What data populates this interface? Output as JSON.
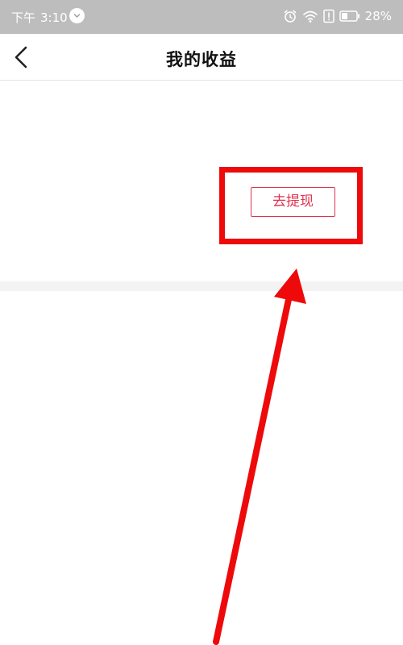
{
  "status_bar": {
    "period": "下午",
    "time": "3:10",
    "battery_percent": "28%",
    "icons": [
      "clock-icon",
      "alarm-icon",
      "wifi-icon",
      "alert-icon",
      "battery-icon"
    ]
  },
  "nav": {
    "back_icon": "chevron-left-icon",
    "title": "我的收益"
  },
  "main": {
    "withdraw_label": "去提现"
  },
  "annotation": {
    "color": "#ee0a0a",
    "icons": [
      "highlight-box",
      "pointer-arrow"
    ]
  },
  "colors": {
    "status_bar_bg": "#bdbdbd",
    "accent": "#e0334f",
    "divider": "#f3f3f3"
  }
}
